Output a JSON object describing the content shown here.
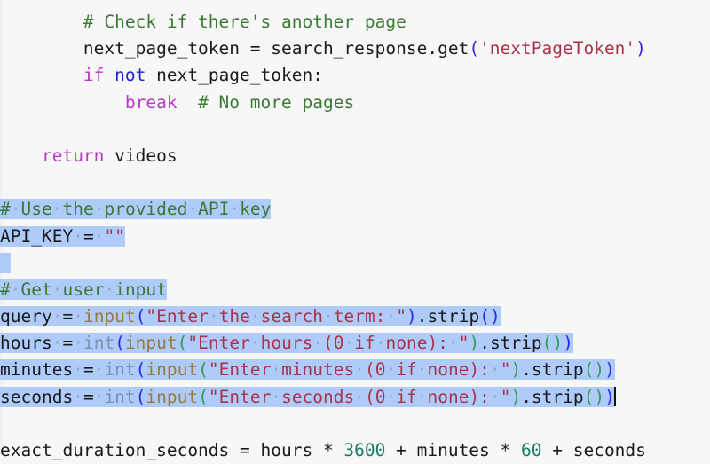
{
  "editor": {
    "name": "python-code-editor",
    "language": "Python",
    "background_color": "#f7f7f7",
    "selection_color": "#aecbfa",
    "caret_color": "#111111",
    "whitespace_dot": "·",
    "theme_colors": {
      "comment": "#3a7a33",
      "keyword": "#b838c8",
      "keyword_operator": "#1c24d6",
      "string": "#a9344a",
      "builtin": "#9b7a35",
      "type": "#7d92b0",
      "number": "#1a7a63",
      "plain": "#1a1a1a",
      "paren_blue": "#2a2ae0",
      "paren_green": "#2f9e4f"
    }
  },
  "lines": [
    {
      "id": "line-1",
      "selected": false,
      "indent": "        ",
      "tokens": [
        {
          "t": "# Check if there's another page",
          "c": "comment"
        }
      ]
    },
    {
      "id": "line-2",
      "selected": false,
      "indent": "        ",
      "tokens": [
        {
          "t": "next_page_token = search_response.get",
          "c": "plain"
        },
        {
          "t": "(",
          "c": "paren-b"
        },
        {
          "t": "'nextPageToken'",
          "c": "string"
        },
        {
          "t": ")",
          "c": "paren-b"
        }
      ]
    },
    {
      "id": "line-3",
      "selected": false,
      "indent": "        ",
      "tokens": [
        {
          "t": "if",
          "c": "keyword"
        },
        {
          "t": " ",
          "c": "plain"
        },
        {
          "t": "not",
          "c": "kw-blue"
        },
        {
          "t": " next_page_token:",
          "c": "plain"
        }
      ]
    },
    {
      "id": "line-4",
      "selected": false,
      "indent": "            ",
      "tokens": [
        {
          "t": "break",
          "c": "keyword"
        },
        {
          "t": "  ",
          "c": "plain"
        },
        {
          "t": "# No more pages",
          "c": "comment"
        }
      ]
    },
    {
      "id": "line-5",
      "selected": false,
      "indent": "",
      "tokens": []
    },
    {
      "id": "line-6",
      "selected": false,
      "indent": "    ",
      "tokens": [
        {
          "t": "return",
          "c": "keyword"
        },
        {
          "t": " videos",
          "c": "plain"
        }
      ]
    },
    {
      "id": "line-7",
      "selected": false,
      "indent": "",
      "tokens": []
    },
    {
      "id": "line-8",
      "selected": true,
      "indent": "",
      "tokens": [
        {
          "t": "#",
          "c": "comment"
        },
        {
          "t": "·",
          "c": "ws"
        },
        {
          "t": "Use",
          "c": "comment"
        },
        {
          "t": "·",
          "c": "ws"
        },
        {
          "t": "the",
          "c": "comment"
        },
        {
          "t": "·",
          "c": "ws"
        },
        {
          "t": "provided",
          "c": "comment"
        },
        {
          "t": "·",
          "c": "ws"
        },
        {
          "t": "API",
          "c": "comment"
        },
        {
          "t": "·",
          "c": "ws"
        },
        {
          "t": "key",
          "c": "comment"
        }
      ]
    },
    {
      "id": "line-9",
      "selected": true,
      "indent": "",
      "tokens": [
        {
          "t": "API_KEY",
          "c": "plain"
        },
        {
          "t": "·",
          "c": "ws"
        },
        {
          "t": "=",
          "c": "plain"
        },
        {
          "t": "·",
          "c": "ws"
        },
        {
          "t": "\"\"",
          "c": "string"
        }
      ]
    },
    {
      "id": "line-10",
      "selected": true,
      "blank_selected": true,
      "indent": "",
      "tokens": []
    },
    {
      "id": "line-11",
      "selected": true,
      "indent": "",
      "tokens": [
        {
          "t": "#",
          "c": "comment"
        },
        {
          "t": "·",
          "c": "ws"
        },
        {
          "t": "Get",
          "c": "comment"
        },
        {
          "t": "·",
          "c": "ws"
        },
        {
          "t": "user",
          "c": "comment"
        },
        {
          "t": "·",
          "c": "ws"
        },
        {
          "t": "input",
          "c": "comment"
        }
      ]
    },
    {
      "id": "line-12",
      "selected": true,
      "indent": "",
      "tokens": [
        {
          "t": "query",
          "c": "plain"
        },
        {
          "t": "·",
          "c": "ws"
        },
        {
          "t": "=",
          "c": "plain"
        },
        {
          "t": "·",
          "c": "ws"
        },
        {
          "t": "input",
          "c": "builtin"
        },
        {
          "t": "(",
          "c": "paren-b"
        },
        {
          "t": "\"Enter",
          "c": "string"
        },
        {
          "t": "·",
          "c": "ws"
        },
        {
          "t": "the",
          "c": "string"
        },
        {
          "t": "·",
          "c": "ws"
        },
        {
          "t": "search",
          "c": "string"
        },
        {
          "t": "·",
          "c": "ws"
        },
        {
          "t": "term:",
          "c": "string"
        },
        {
          "t": "·",
          "c": "ws"
        },
        {
          "t": "\"",
          "c": "string"
        },
        {
          "t": ")",
          "c": "paren-b"
        },
        {
          "t": ".strip",
          "c": "plain"
        },
        {
          "t": "()",
          "c": "paren-b"
        }
      ]
    },
    {
      "id": "line-13",
      "selected": true,
      "indent": "",
      "tokens": [
        {
          "t": "hours",
          "c": "plain"
        },
        {
          "t": "·",
          "c": "ws"
        },
        {
          "t": "=",
          "c": "plain"
        },
        {
          "t": "·",
          "c": "ws"
        },
        {
          "t": "int",
          "c": "type"
        },
        {
          "t": "(",
          "c": "paren-b"
        },
        {
          "t": "input",
          "c": "builtin"
        },
        {
          "t": "(",
          "c": "paren-g"
        },
        {
          "t": "\"Enter",
          "c": "string"
        },
        {
          "t": "·",
          "c": "ws"
        },
        {
          "t": "hours",
          "c": "string"
        },
        {
          "t": "·",
          "c": "ws"
        },
        {
          "t": "(0",
          "c": "string"
        },
        {
          "t": "·",
          "c": "ws"
        },
        {
          "t": "if",
          "c": "string"
        },
        {
          "t": "·",
          "c": "ws"
        },
        {
          "t": "none):",
          "c": "string"
        },
        {
          "t": "·",
          "c": "ws"
        },
        {
          "t": "\"",
          "c": "string"
        },
        {
          "t": ")",
          "c": "paren-g"
        },
        {
          "t": ".strip",
          "c": "plain"
        },
        {
          "t": "()",
          "c": "paren-g"
        },
        {
          "t": ")",
          "c": "paren-b"
        }
      ]
    },
    {
      "id": "line-14",
      "selected": true,
      "indent": "",
      "tokens": [
        {
          "t": "minutes",
          "c": "plain"
        },
        {
          "t": "·",
          "c": "ws"
        },
        {
          "t": "=",
          "c": "plain"
        },
        {
          "t": "·",
          "c": "ws"
        },
        {
          "t": "int",
          "c": "type"
        },
        {
          "t": "(",
          "c": "paren-b"
        },
        {
          "t": "input",
          "c": "builtin"
        },
        {
          "t": "(",
          "c": "paren-g"
        },
        {
          "t": "\"Enter",
          "c": "string"
        },
        {
          "t": "·",
          "c": "ws"
        },
        {
          "t": "minutes",
          "c": "string"
        },
        {
          "t": "·",
          "c": "ws"
        },
        {
          "t": "(0",
          "c": "string"
        },
        {
          "t": "·",
          "c": "ws"
        },
        {
          "t": "if",
          "c": "string"
        },
        {
          "t": "·",
          "c": "ws"
        },
        {
          "t": "none):",
          "c": "string"
        },
        {
          "t": "·",
          "c": "ws"
        },
        {
          "t": "\"",
          "c": "string"
        },
        {
          "t": ")",
          "c": "paren-g"
        },
        {
          "t": ".strip",
          "c": "plain"
        },
        {
          "t": "()",
          "c": "paren-g"
        },
        {
          "t": ")",
          "c": "paren-b"
        }
      ]
    },
    {
      "id": "line-15",
      "selected": true,
      "caret_at_end": true,
      "indent": "",
      "tokens": [
        {
          "t": "seconds",
          "c": "plain"
        },
        {
          "t": "·",
          "c": "ws"
        },
        {
          "t": "=",
          "c": "plain"
        },
        {
          "t": "·",
          "c": "ws"
        },
        {
          "t": "int",
          "c": "type"
        },
        {
          "t": "(",
          "c": "paren-b"
        },
        {
          "t": "input",
          "c": "builtin"
        },
        {
          "t": "(",
          "c": "paren-g"
        },
        {
          "t": "\"Enter",
          "c": "string"
        },
        {
          "t": "·",
          "c": "ws"
        },
        {
          "t": "seconds",
          "c": "string"
        },
        {
          "t": "·",
          "c": "ws"
        },
        {
          "t": "(0",
          "c": "string"
        },
        {
          "t": "·",
          "c": "ws"
        },
        {
          "t": "if",
          "c": "string"
        },
        {
          "t": "·",
          "c": "ws"
        },
        {
          "t": "none):",
          "c": "string"
        },
        {
          "t": "·",
          "c": "ws"
        },
        {
          "t": "\"",
          "c": "string"
        },
        {
          "t": ")",
          "c": "paren-g"
        },
        {
          "t": ".strip",
          "c": "plain"
        },
        {
          "t": "()",
          "c": "paren-g"
        },
        {
          "t": ")",
          "c": "paren-b"
        }
      ]
    },
    {
      "id": "line-16",
      "selected": false,
      "indent": "",
      "tokens": []
    },
    {
      "id": "line-17",
      "selected": false,
      "indent": "",
      "tokens": [
        {
          "t": "exact_duration_seconds = hours * ",
          "c": "plain"
        },
        {
          "t": "3600",
          "c": "number"
        },
        {
          "t": " + minutes * ",
          "c": "plain"
        },
        {
          "t": "60",
          "c": "number"
        },
        {
          "t": " + seconds",
          "c": "plain"
        }
      ]
    }
  ]
}
